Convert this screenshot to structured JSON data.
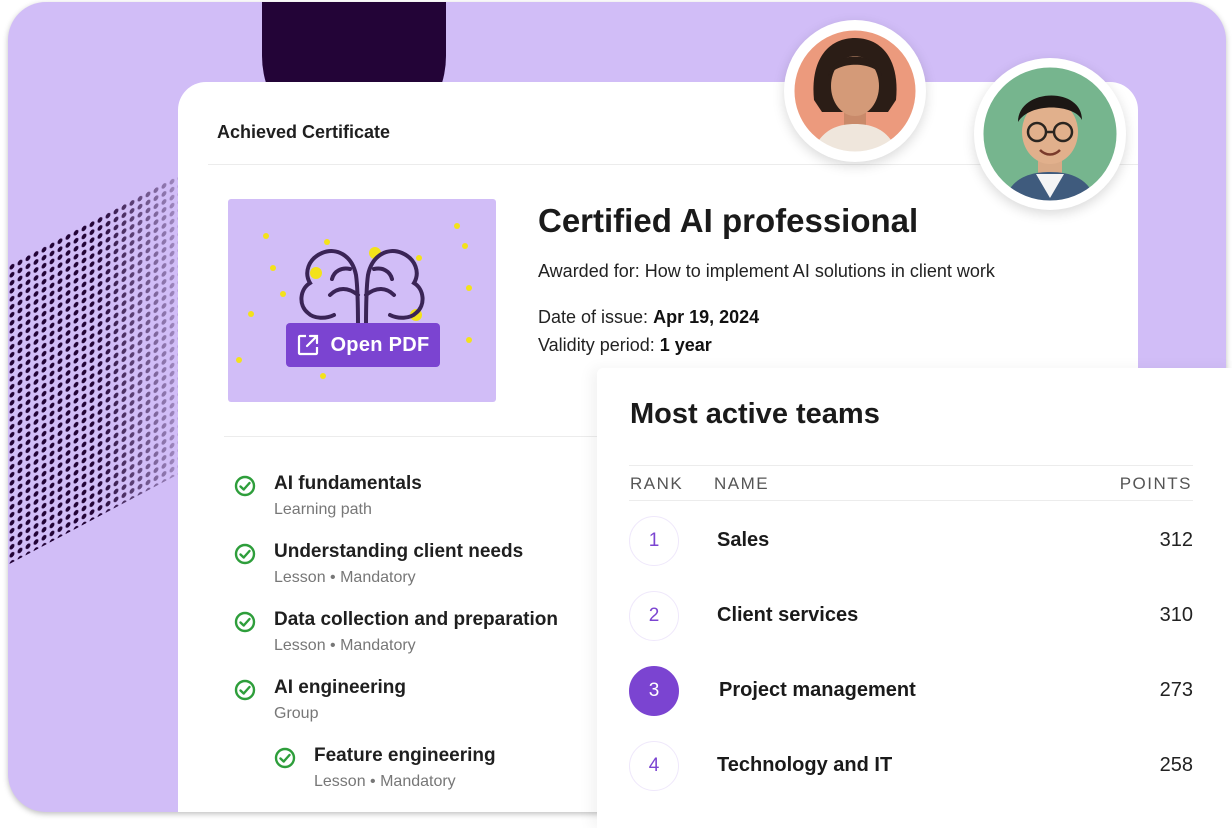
{
  "certificate": {
    "header": "Achieved Certificate",
    "title": "Certified AI professional",
    "awarded_label": "Awarded for:",
    "awarded_value": "How to implement AI solutions in client work",
    "date_label": "Date of issue:",
    "date_value": "Apr 19, 2024",
    "validity_label": "Validity period:",
    "validity_value": "1 year",
    "open_pdf_label": "Open PDF",
    "thumb_icon": "brain-icon"
  },
  "courses": [
    {
      "title": "AI fundamentals",
      "sub": "Learning path"
    },
    {
      "title": "Understanding client needs",
      "sub": "Lesson • Mandatory"
    },
    {
      "title": "Data collection and preparation",
      "sub": "Lesson • Mandatory"
    },
    {
      "title": "AI engineering",
      "sub": "Group"
    },
    {
      "title": "Feature engineering",
      "sub": "Lesson • Mandatory"
    }
  ],
  "teams": {
    "title": "Most active teams",
    "columns": {
      "rank": "RANK",
      "name": "NAME",
      "points": "POINTS"
    },
    "rows": [
      {
        "rank": "1",
        "name": "Sales",
        "points": "312"
      },
      {
        "rank": "2",
        "name": "Client services",
        "points": "310"
      },
      {
        "rank": "3",
        "name": "Project management",
        "points": "273"
      },
      {
        "rank": "4",
        "name": "Technology and IT",
        "points": "258"
      }
    ]
  },
  "colors": {
    "background": "#d1bdf7",
    "accent": "#7b44d1",
    "dark": "#230437",
    "check": "#2e9e3b",
    "sparkle": "#f3e21a"
  }
}
